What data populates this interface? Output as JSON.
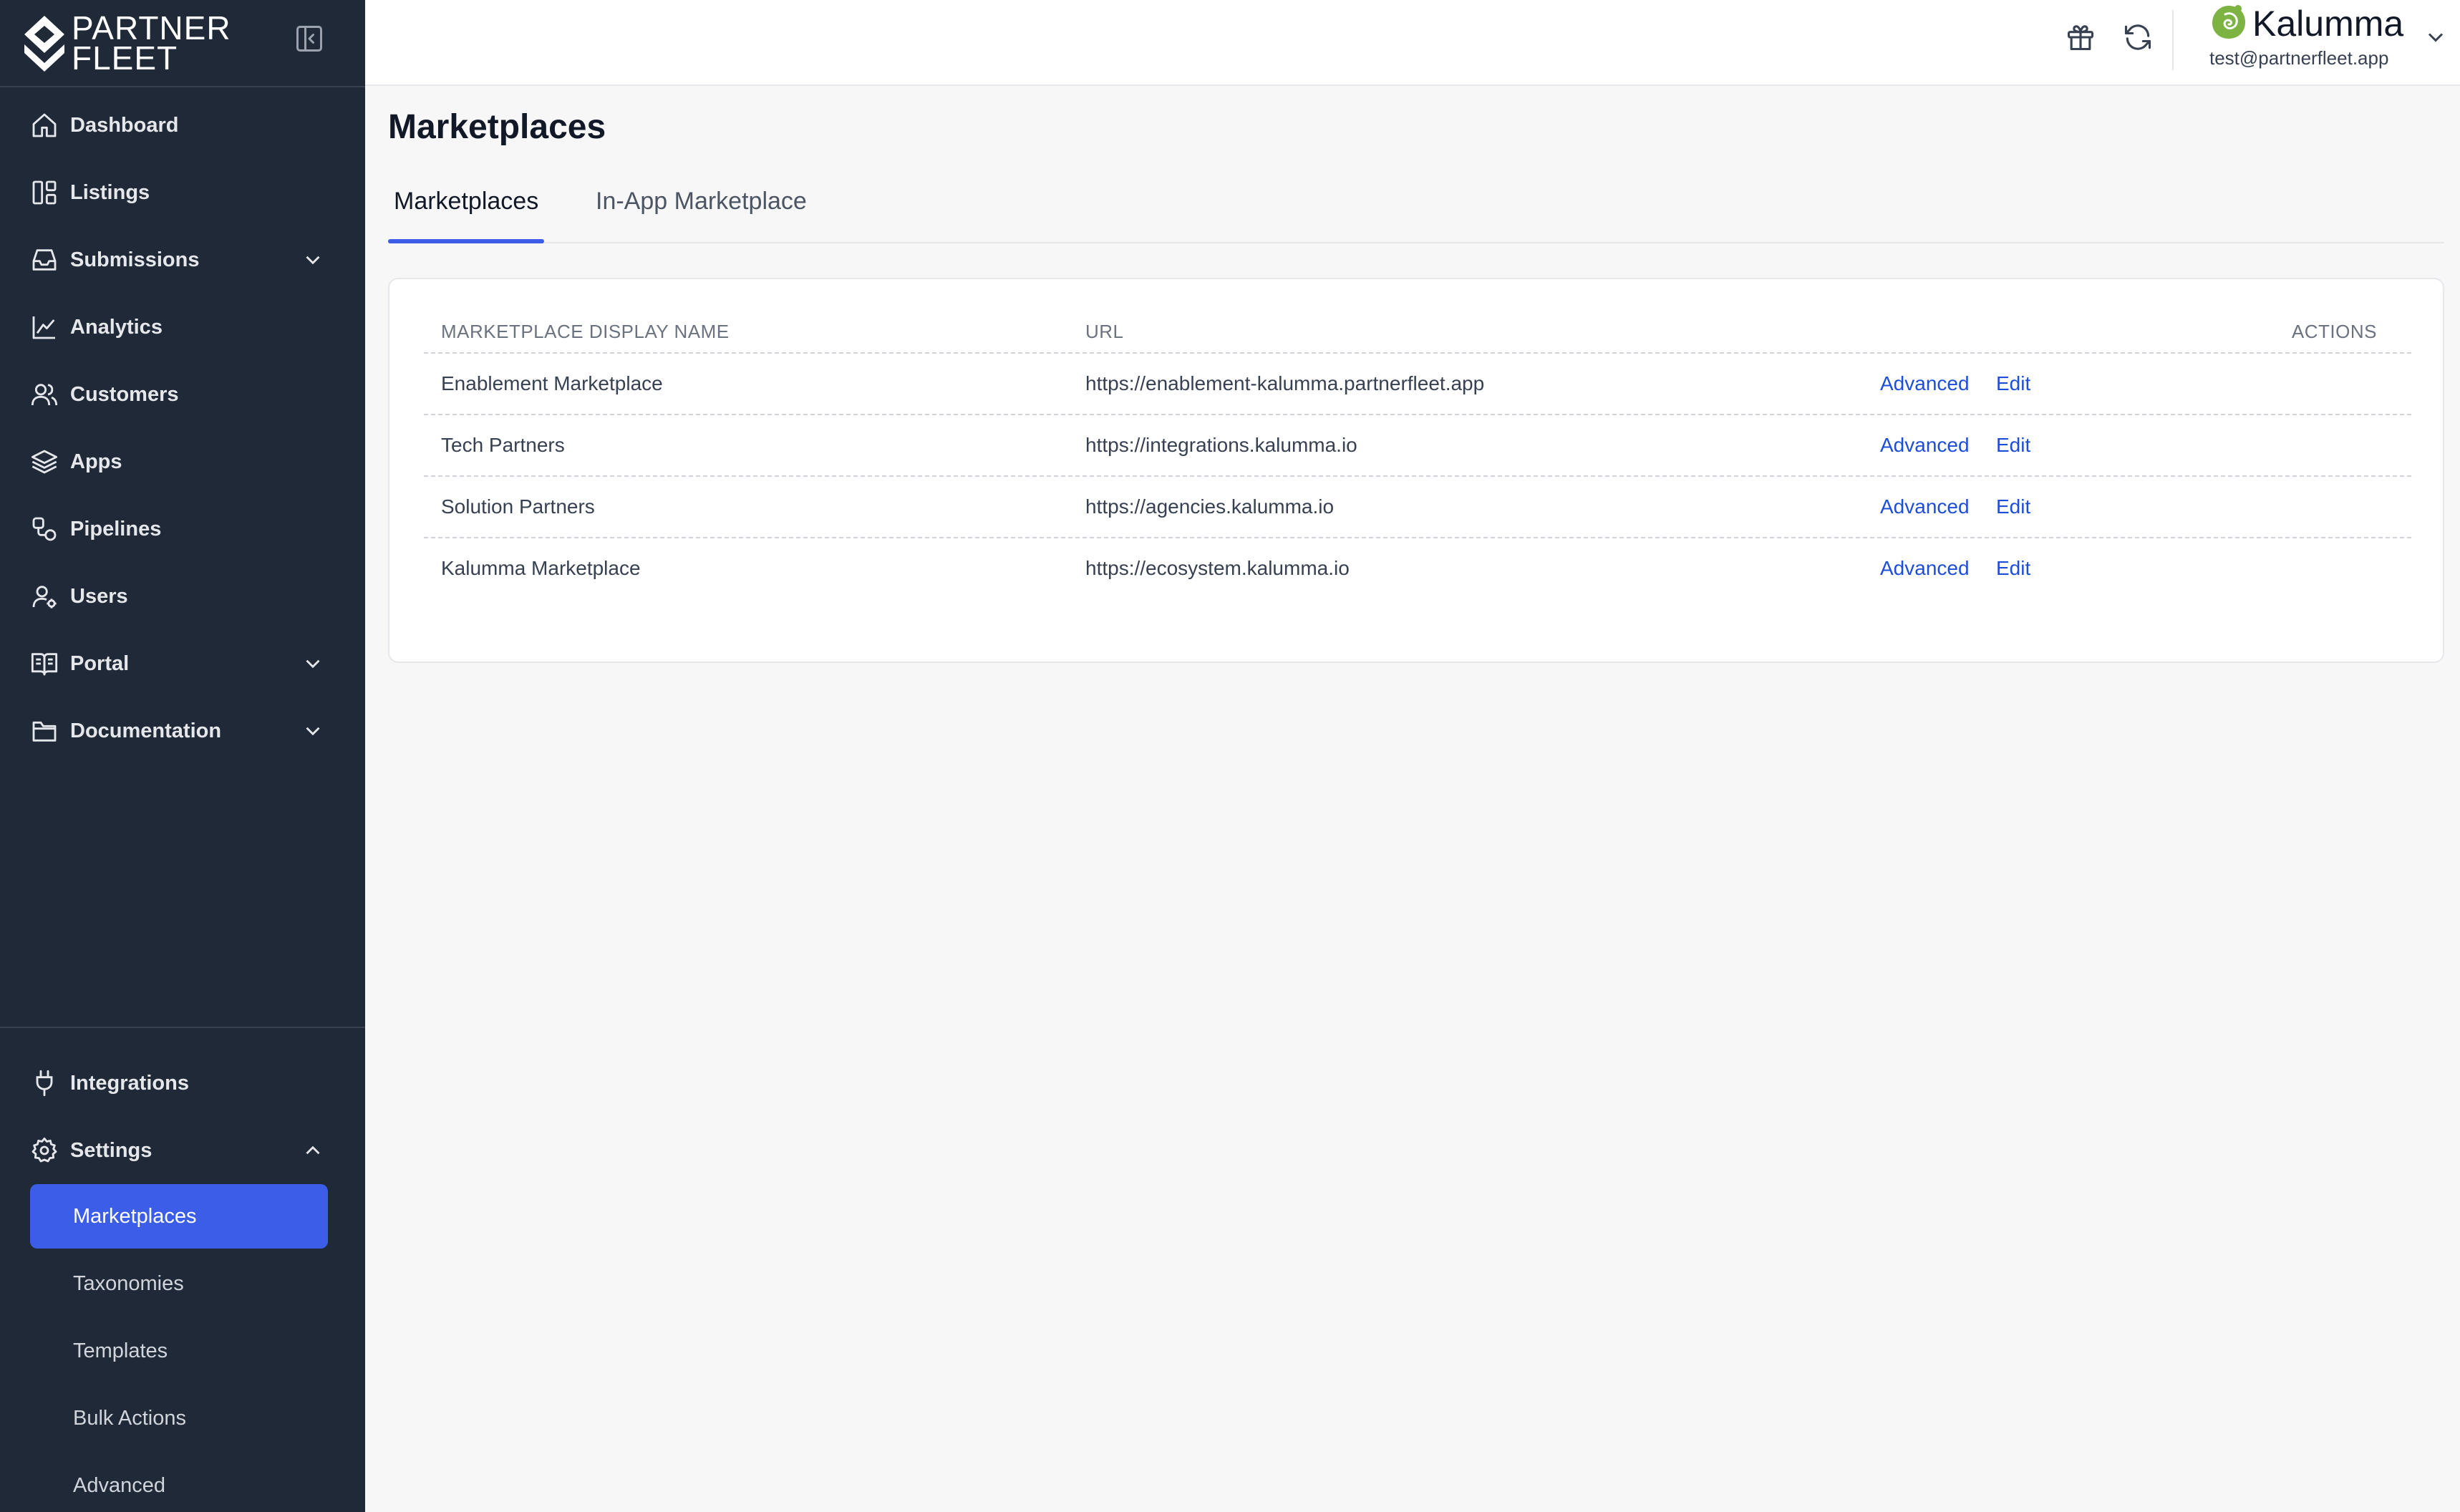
{
  "brand": {
    "line1": "PARTNER",
    "line2": "FLEET"
  },
  "sidebar": {
    "nav": [
      {
        "label": "Dashboard",
        "icon": "home-icon"
      },
      {
        "label": "Listings",
        "icon": "layout-icon"
      },
      {
        "label": "Submissions",
        "icon": "inbox-icon",
        "expandable": true
      },
      {
        "label": "Analytics",
        "icon": "chart-line-icon"
      },
      {
        "label": "Customers",
        "icon": "users-icon"
      },
      {
        "label": "Apps",
        "icon": "layers-icon"
      },
      {
        "label": "Pipelines",
        "icon": "pipeline-icon"
      },
      {
        "label": "Users",
        "icon": "user-gear-icon"
      },
      {
        "label": "Portal",
        "icon": "book-icon",
        "expandable": true
      },
      {
        "label": "Documentation",
        "icon": "folder-icon",
        "expandable": true
      }
    ],
    "bottom": [
      {
        "label": "Integrations",
        "icon": "plug-icon"
      },
      {
        "label": "Settings",
        "icon": "gear-icon",
        "expanded": true
      }
    ],
    "settings_children": [
      {
        "label": "Marketplaces",
        "active": true
      },
      {
        "label": "Taxonomies"
      },
      {
        "label": "Templates"
      },
      {
        "label": "Bulk Actions"
      },
      {
        "label": "Advanced"
      }
    ]
  },
  "header": {
    "company": "Kalumma",
    "email": "test@partnerfleet.app",
    "icons": [
      "gift-icon",
      "refresh-icon"
    ]
  },
  "page": {
    "title": "Marketplaces",
    "tabs": [
      "Marketplaces",
      "In-App Marketplace"
    ],
    "active_tab": "Marketplaces"
  },
  "table": {
    "columns": [
      "MARKETPLACE DISPLAY NAME",
      "URL",
      "ACTIONS"
    ],
    "rows": [
      {
        "name": "Enablement Marketplace",
        "url": "https://enablement-kalumma.partnerfleet.app",
        "advanced": "Advanced",
        "edit": "Edit"
      },
      {
        "name": "Tech Partners",
        "url": "https://integrations.kalumma.io",
        "advanced": "Advanced",
        "edit": "Edit"
      },
      {
        "name": "Solution Partners",
        "url": "https://agencies.kalumma.io",
        "advanced": "Advanced",
        "edit": "Edit"
      },
      {
        "name": "Kalumma Marketplace",
        "url": "https://ecosystem.kalumma.io",
        "advanced": "Advanced",
        "edit": "Edit"
      }
    ]
  },
  "colors": {
    "sidebar_bg": "#1f2937",
    "accent": "#3b5de7",
    "link": "#1d4ed8",
    "page_bg": "#f7f7f7",
    "brand_green": "#7cb342"
  }
}
